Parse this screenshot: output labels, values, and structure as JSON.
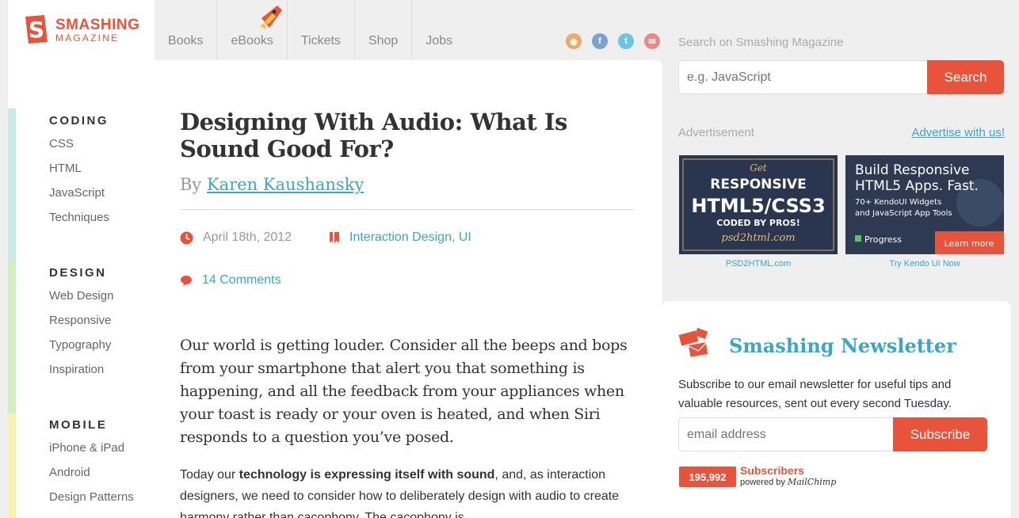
{
  "logo": {
    "line1": "SMASHING",
    "line2": "MAGAZINE",
    "icon": "smashing-s-logo"
  },
  "nav": {
    "items": [
      "Books",
      "eBooks",
      "Tickets",
      "Shop",
      "Jobs"
    ]
  },
  "social": [
    "rss-icon",
    "facebook-icon",
    "twitter-icon",
    "newsletter-icon"
  ],
  "sidebar": {
    "categories": [
      {
        "title": "CODING",
        "links": [
          "CSS",
          "HTML",
          "JavaScript",
          "Techniques"
        ]
      },
      {
        "title": "DESIGN",
        "links": [
          "Web Design",
          "Responsive",
          "Typography",
          "Inspiration"
        ]
      },
      {
        "title": "MOBILE",
        "links": [
          "iPhone & iPad",
          "Android",
          "Design Patterns"
        ]
      }
    ]
  },
  "article": {
    "title": "Designing With Audio: What Is Sound Good For?",
    "by": "By",
    "author": "Karen Kaushansky",
    "date": "April 18th, 2012",
    "tags": "Interaction Design, UI",
    "comments": "14 Comments",
    "lead": "Our world is getting louder. Consider all the beeps and bops from your smartphone that alert you that something is happening, and all the feedback from your appliances when your toast is ready or your oven is heated, and when Siri responds to a question you’ve posed.",
    "para_start": "Today our ",
    "para_bold": "technology is expressing itself with sound",
    "para_end": ", and, as interaction designers, we need to consider how to deliberately design with audio to create harmony rather than cacophony. The cacophony is"
  },
  "search": {
    "label": "Search on Smashing Magazine",
    "placeholder": "e.g. JavaScript",
    "button": "Search"
  },
  "ads": {
    "label": "Advertisement",
    "link": "Advertise with us!",
    "ad1": {
      "line1": "Get",
      "line2": "RESPONSIVE",
      "line3": "HTML5/CSS3",
      "line4": "CODED BY PROS!",
      "line5": "psd2html.com",
      "caption": "PSD2HTML.com"
    },
    "ad2": {
      "line1": "Build Responsive",
      "line2": "HTML5 Apps. Fast.",
      "line3": "70+ KendoUI Widgets",
      "line4": "and JavaScript App Tools",
      "brand": "Progress",
      "cta": "Learn more",
      "caption": "Try Kendo UI Now"
    }
  },
  "newsletter": {
    "title": "Smashing Newsletter",
    "desc": "Subscribe to our email newsletter for useful tips and valuable resources, sent out every second Tuesday.",
    "placeholder": "email address",
    "button": "Subscribe",
    "count": "195,992",
    "sub_label": "Subscribers",
    "powered": "powered by",
    "provider": "MailChimp"
  },
  "colors": {
    "accent": "#e8533b",
    "link": "#3aa6c8"
  }
}
